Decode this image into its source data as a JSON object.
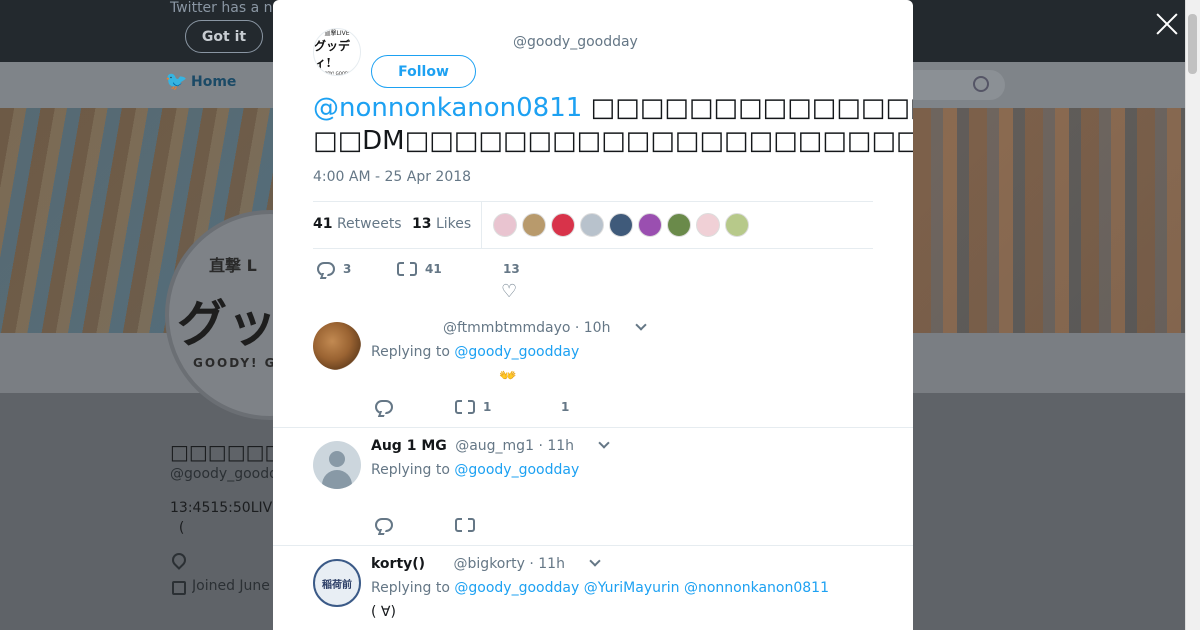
{
  "background": {
    "cookie_text": "Twitter has a n",
    "got_it_label": "Got it",
    "home_label": "Home",
    "avatar_small": "直撃 L",
    "avatar_big": "グッテ",
    "avatar_brand": "GOODY! G",
    "profile_name": "□□□□□□□□□□□□□",
    "profile_handle": "@goody_goodd",
    "profile_bio_1": "13:4515:50LIV",
    "profile_bio_2": "  (",
    "joined": "Joined June"
  },
  "tweet": {
    "avatar_line1": "直撃LIVE",
    "avatar_line2": "グッディ!",
    "avatar_line3": "GOODY! GOODDAY",
    "follow_label": "Follow",
    "handle": "@goody_goodday",
    "mention": "@nonnonkanon0811",
    "text_line1_rest": " □□□□□□□□□□□□□□□□□□□□□□LIVE□□□□□□□□□□□□□□□□□□□□",
    "text_line2": "□□DM□□□□□□□□□□□□□□□□□□□□□□□□□□□□□□□□□□□□□□□□□□□□□",
    "date": "4:00 AM - 25 Apr 2018",
    "retweets_count": "41",
    "retweets_label": "Retweets",
    "likes_count": "13",
    "likes_label": "Likes",
    "liker_colors": [
      "#e9c4d0",
      "#b89a6c",
      "#d8334a",
      "#b8c2cc",
      "#3f5a7a",
      "#9a4fb0",
      "#6a8a4a",
      "#f0d0d6",
      "#b7c98a"
    ],
    "actions": {
      "replies": "3",
      "retweets": "41",
      "likes": "13"
    }
  },
  "replies": [
    {
      "name": "",
      "handle": "@ftmmbtmmdayo",
      "time": "· 10h",
      "replying_label": "Replying to",
      "replying_to": [
        "@goody_goodday"
      ],
      "body": "👐",
      "actions": {
        "replies": "",
        "retweets": "1",
        "likes": "1"
      }
    },
    {
      "name": "Aug 1 MG",
      "handle": "@aug_mg1",
      "time": "· 11h",
      "replying_label": "Replying to",
      "replying_to": [
        "@goody_goodday"
      ],
      "body": "",
      "actions": {
        "replies": "",
        "retweets": "",
        "likes": ""
      }
    },
    {
      "name": "korty()",
      "handle": "@bigkorty",
      "time": "· 11h",
      "replying_label": "Replying to",
      "replying_to": [
        "@goody_goodday",
        "@YuriMayurin",
        "@nonnonkanon0811"
      ],
      "avatar_text": "稲荷前",
      "body": "( ∀)",
      "actions": {
        "replies": "",
        "retweets": "",
        "likes": ""
      }
    }
  ]
}
